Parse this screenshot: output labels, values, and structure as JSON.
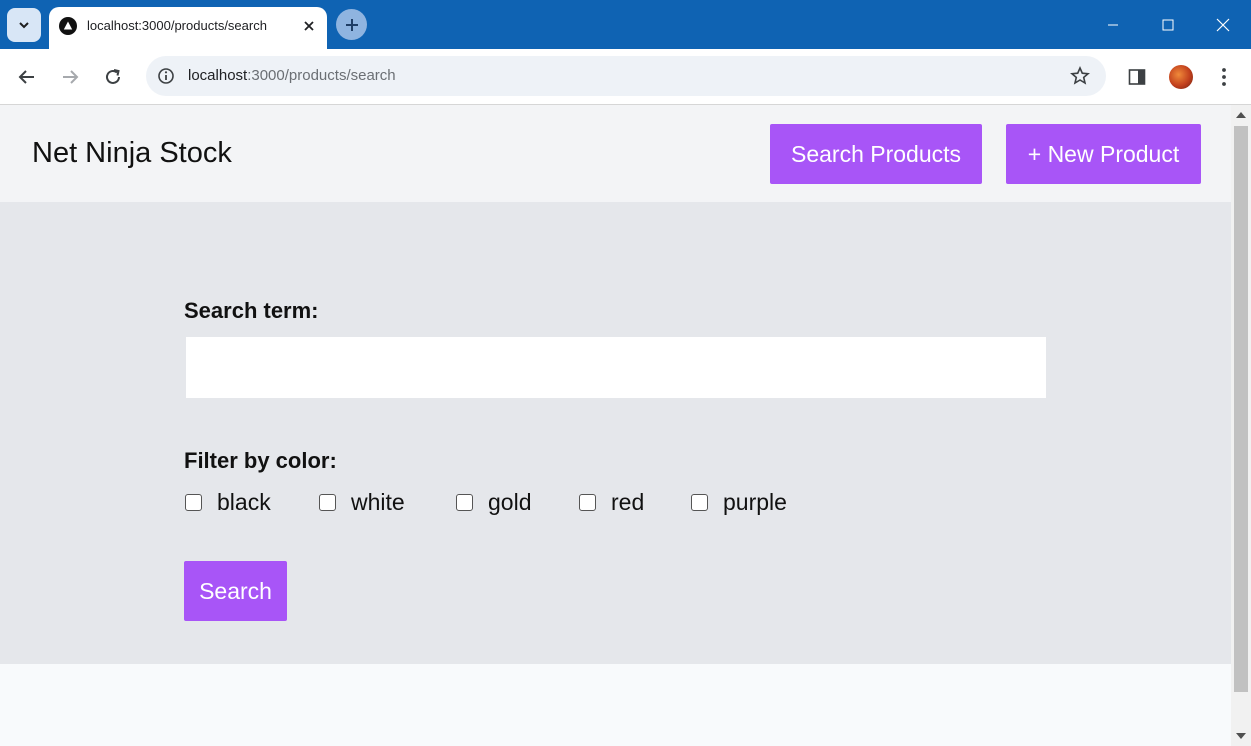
{
  "browser": {
    "tab": {
      "title": "localhost:3000/products/search",
      "favicon": "nextjs-triangle-icon"
    },
    "address": {
      "host": "localhost",
      "rest": ":3000/products/search"
    },
    "colors": {
      "titlebar": "#0f63b3",
      "omnibox": "#eef2f7"
    }
  },
  "site": {
    "brand": "Net Ninja Stock",
    "nav": {
      "search_products": "Search Products",
      "new_product": "+ New Product"
    }
  },
  "form": {
    "search_label": "Search term:",
    "search_value": "",
    "filter_label": "Filter by color:",
    "colors": [
      "black",
      "white",
      "gold",
      "red",
      "purple"
    ],
    "submit_label": "Search"
  },
  "theme": {
    "accent": "#a855f7",
    "nav_bg": "#f3f4f6",
    "main_bg": "#e5e7eb",
    "page_bg": "#f8fafc"
  }
}
